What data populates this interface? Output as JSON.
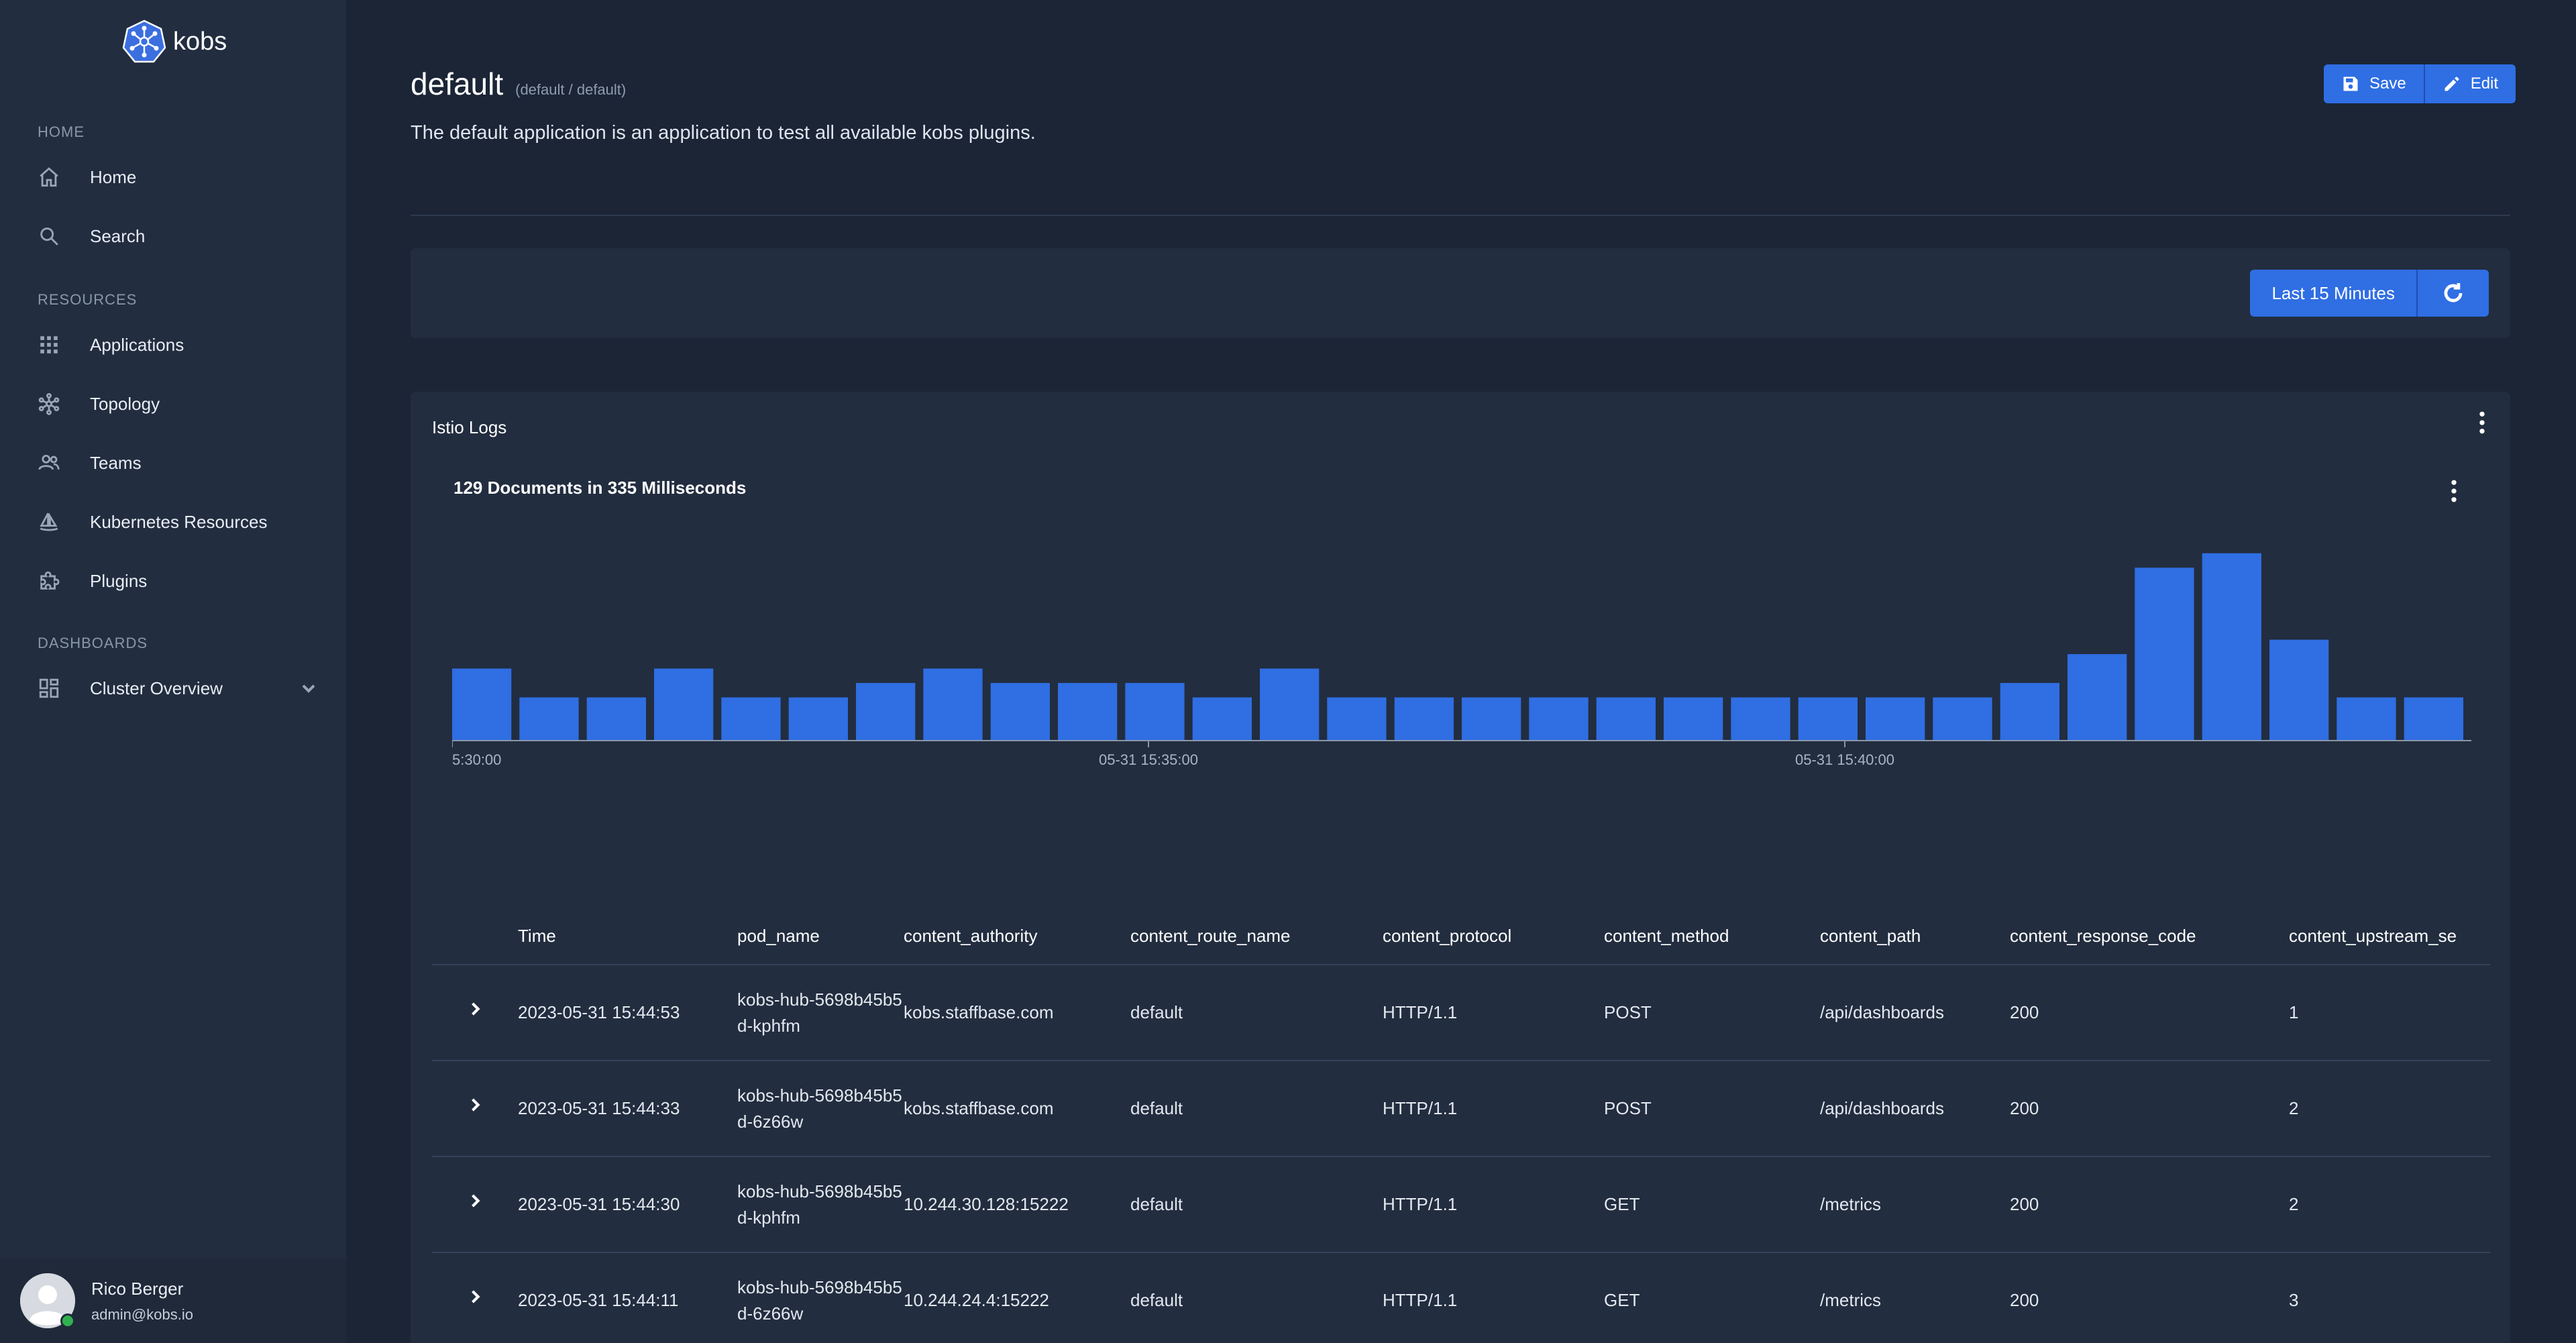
{
  "app": {
    "name": "kobs"
  },
  "sidebar": {
    "sections": [
      {
        "label": "HOME",
        "items": [
          {
            "label": "Home",
            "icon": "home-icon"
          },
          {
            "label": "Search",
            "icon": "search-icon"
          }
        ]
      },
      {
        "label": "RESOURCES",
        "items": [
          {
            "label": "Applications",
            "icon": "grid-icon"
          },
          {
            "label": "Topology",
            "icon": "topology-icon"
          },
          {
            "label": "Teams",
            "icon": "people-icon"
          },
          {
            "label": "Kubernetes Resources",
            "icon": "sailboat-icon"
          },
          {
            "label": "Plugins",
            "icon": "puzzle-icon"
          }
        ]
      },
      {
        "label": "DASHBOARDS",
        "items": [
          {
            "label": "Cluster Overview",
            "icon": "dashboard-icon"
          }
        ]
      }
    ]
  },
  "user": {
    "name": "Rico Berger",
    "email": "admin@kobs.io"
  },
  "header": {
    "title": "default",
    "subtitle": "(default / default)",
    "description": "The default application is an application to test all available kobs plugins.",
    "save_label": "Save",
    "edit_label": "Edit"
  },
  "toolbar": {
    "time_range": "Last 15 Minutes"
  },
  "logs": {
    "title": "Istio Logs",
    "summary": "129 Documents in 335 Milliseconds"
  },
  "chart_data": {
    "type": "bar",
    "title": "",
    "xlabel": "",
    "ylabel": "",
    "x_tick_labels": [
      "5:30:00",
      "05-31 15:35:00",
      "05-31 15:40:00"
    ],
    "values": [
      5,
      3,
      3,
      5,
      3,
      3,
      4,
      5,
      4,
      4,
      4,
      3,
      5,
      3,
      3,
      3,
      3,
      3,
      3,
      3,
      3,
      3,
      3,
      4,
      6,
      12,
      13,
      7,
      3,
      3
    ],
    "ylim": [
      0,
      13.5
    ],
    "color": "#2f6ee3"
  },
  "table": {
    "columns": [
      "Time",
      "pod_name",
      "content_authority",
      "content_route_name",
      "content_protocol",
      "content_method",
      "content_path",
      "content_response_code",
      "content_upstream_se"
    ],
    "rows": [
      [
        "2023-05-31 15:44:53",
        "kobs-hub-5698b45b5d-kphfm",
        "kobs.staffbase.com",
        "default",
        "HTTP/1.1",
        "POST",
        "/api/dashboards",
        "200",
        "1"
      ],
      [
        "2023-05-31 15:44:33",
        "kobs-hub-5698b45b5d-6z66w",
        "kobs.staffbase.com",
        "default",
        "HTTP/1.1",
        "POST",
        "/api/dashboards",
        "200",
        "2"
      ],
      [
        "2023-05-31 15:44:30",
        "kobs-hub-5698b45b5d-kphfm",
        "10.244.30.128:15222",
        "default",
        "HTTP/1.1",
        "GET",
        "/metrics",
        "200",
        "2"
      ],
      [
        "2023-05-31 15:44:11",
        "kobs-hub-5698b45b5d-6z66w",
        "10.244.24.4:15222",
        "default",
        "HTTP/1.1",
        "GET",
        "/metrics",
        "200",
        "3"
      ]
    ]
  }
}
